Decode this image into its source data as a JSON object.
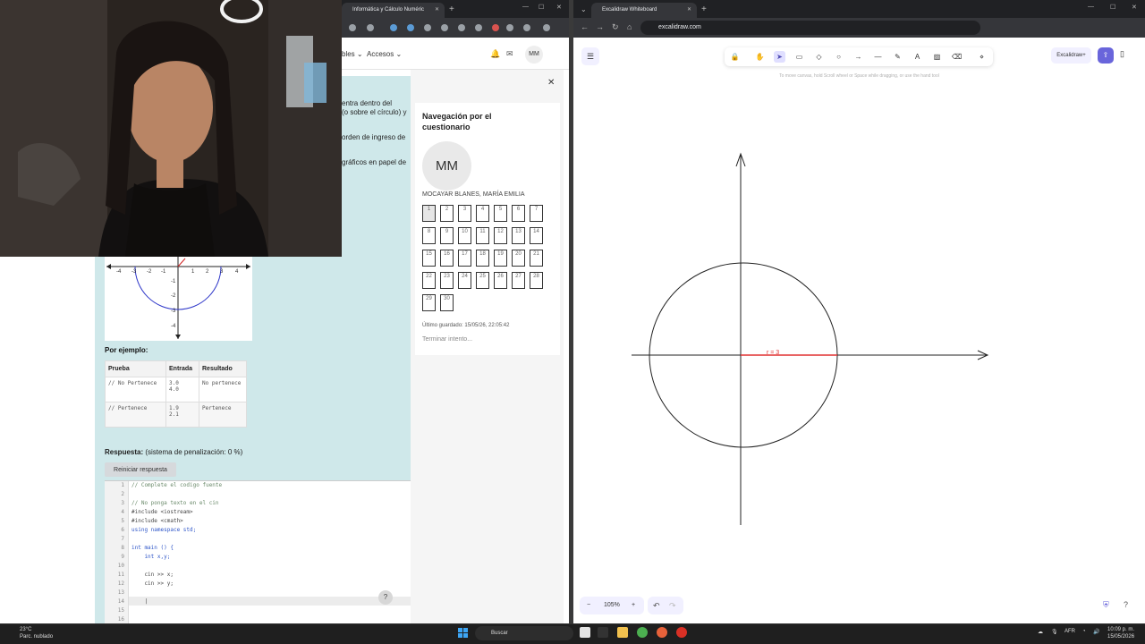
{
  "left_browser": {
    "tab_title": "Informática y Cálculo Numéric",
    "moodle_menu": [
      "bles",
      "Accesos"
    ],
    "user_initials": "MM",
    "question_text": [
      "entra dentro del\n(o sobre el círculo) y",
      "orden de ingreso de",
      "gráficos en papel de"
    ],
    "example_heading": "Por ejemplo:",
    "table": {
      "headers": [
        "Prueba",
        "Entrada",
        "Resultado"
      ],
      "rows": [
        [
          "// No Pertenece",
          "3.0\n4.0",
          "No pertenece"
        ],
        [
          "// Pertenece",
          "1.9\n2.1",
          "Pertenece"
        ]
      ]
    },
    "answer_label": "Respuesta:",
    "answer_penalty": "(sistema de penalización: 0 %)",
    "reset_button": "Reiniciar respuesta",
    "code_lines": [
      {
        "n": "1",
        "text": "// Complete el codigo fuente",
        "kind": "comment"
      },
      {
        "n": "2",
        "text": "",
        "kind": "plain"
      },
      {
        "n": "3",
        "text": "// No ponga texto en el cin",
        "kind": "comment"
      },
      {
        "n": "4",
        "text": "#include <iostream>",
        "kind": "plain"
      },
      {
        "n": "5",
        "text": "#include <cmath>",
        "kind": "plain"
      },
      {
        "n": "6",
        "text": "using namespace std;",
        "kind": "kw"
      },
      {
        "n": "7",
        "text": "",
        "kind": "plain"
      },
      {
        "n": "8",
        "text": "int main () {",
        "kind": "kw"
      },
      {
        "n": "9",
        "text": "    int x,y;",
        "kind": "kw"
      },
      {
        "n": "10",
        "text": "",
        "kind": "plain"
      },
      {
        "n": "11",
        "text": "    cin >> x;",
        "kind": "plain"
      },
      {
        "n": "12",
        "text": "    cin >> y;",
        "kind": "plain"
      },
      {
        "n": "13",
        "text": "",
        "kind": "plain"
      },
      {
        "n": "14",
        "text": "    |",
        "kind": "plain"
      },
      {
        "n": "15",
        "text": "",
        "kind": "plain"
      },
      {
        "n": "16",
        "text": "",
        "kind": "plain"
      }
    ],
    "help_button": "?",
    "nav": {
      "title": "Navegación por el cuestionario",
      "avatar": "MM",
      "user_name": "MOCAYAR BLANES, MARÍA EMILIA",
      "questions": [
        "1",
        "2",
        "3",
        "4",
        "5",
        "6",
        "7",
        "8",
        "9",
        "10",
        "11",
        "12",
        "13",
        "14",
        "15",
        "16",
        "17",
        "18",
        "19",
        "20",
        "21",
        "22",
        "23",
        "24",
        "25",
        "26",
        "27",
        "28",
        "29",
        "30"
      ],
      "current_question": 1,
      "last_saved": "Último guardado: 15/05/26, 22:05:42",
      "finish": "Terminar intento..."
    },
    "graph_ticks": [
      "-4",
      "-3",
      "-2",
      "-1",
      "1",
      "2",
      "3",
      "4",
      "-1",
      "-2",
      "-3",
      "-4"
    ]
  },
  "right_browser": {
    "tab_title": "Excalidraw Whiteboard",
    "url": "excalidraw.com",
    "hint": "To move canvas, hold Scroll wheel or Space while dragging, or use the hand tool",
    "library_button": "Excalidraw+",
    "zoom": "105%",
    "radius_label": "r = 3"
  },
  "taskbar": {
    "weather_temp": "23°C",
    "weather_desc": "Parc. nublado",
    "search": "Buscar",
    "lang": "AFR",
    "time": "10:09 p. m.",
    "date": "15/05/2026"
  }
}
